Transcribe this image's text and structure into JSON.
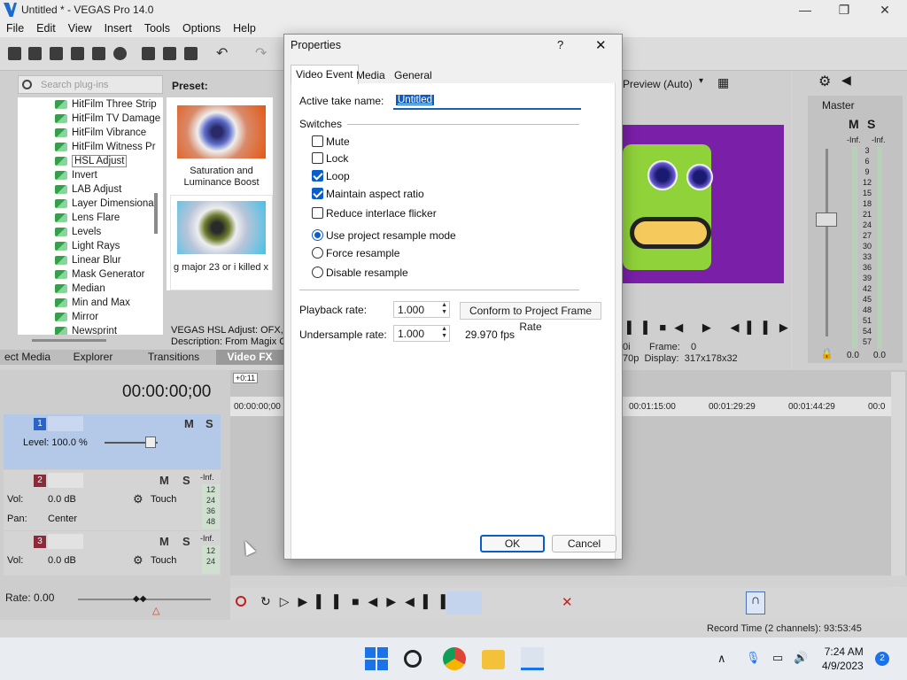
{
  "app": {
    "title": "Untitled * - VEGAS Pro 14.0",
    "menu": [
      "File",
      "Edit",
      "View",
      "Insert",
      "Tools",
      "Options",
      "Help"
    ]
  },
  "plugins": {
    "search_placeholder": "Search plug-ins",
    "preset_label": "Preset:",
    "items": [
      "HitFilm Three Strip",
      "HitFilm TV Damage",
      "HitFilm Vibrance",
      "HitFilm Witness Pr",
      "HSL Adjust",
      "Invert",
      "LAB Adjust",
      "Layer Dimensional",
      "Lens Flare",
      "Levels",
      "Light Rays",
      "Linear Blur",
      "Mask Generator",
      "Median",
      "Min and Max",
      "Mirror",
      "Newsprint"
    ],
    "selected_index": 4,
    "presets": [
      {
        "label": "Saturation and Luminance Boost"
      },
      {
        "label": "g major 23 or i killed x"
      }
    ],
    "description_line1": "VEGAS HSL Adjust: OFX, 32",
    "description_line2": "Description: From Magix Co",
    "tabs": [
      "ect Media",
      "Explorer",
      "Transitions",
      "Video FX"
    ]
  },
  "timeline": {
    "timecode": "00:00:00;00",
    "offset_badge": "+0:11",
    "ruler_marks": [
      "00:00:00;00",
      "00:01:15:00",
      "00:01:29:29",
      "00:01:44:29",
      "00:0"
    ],
    "rate": "Rate: 0.00",
    "tracks": [
      {
        "num": "1",
        "level_label": "Level: 100.0 %"
      },
      {
        "num": "2",
        "vol_label": "Vol:",
        "vol_value": "0.0 dB",
        "pan_label": "Pan:",
        "pan_value": "Center",
        "touch": "Touch"
      },
      {
        "num": "3",
        "vol_label": "Vol:",
        "vol_value": "0.0 dB",
        "touch": "Touch"
      }
    ],
    "meter_values": [
      "-Inf.",
      "12",
      "24",
      "36",
      "48"
    ]
  },
  "preview": {
    "mode": "Preview (Auto)",
    "frame_label": "Frame:",
    "frame_value": "0",
    "display_label": "Display:",
    "display_value": "317x178x32",
    "res_fragment1": "0i",
    "res_fragment2": "70p"
  },
  "master": {
    "label": "Master",
    "inf_left": "-Inf.",
    "inf_right": "-Inf.",
    "scale": [
      "3",
      "6",
      "9",
      "12",
      "15",
      "18",
      "21",
      "24",
      "27",
      "30",
      "33",
      "36",
      "39",
      "42",
      "45",
      "48",
      "51",
      "54",
      "57"
    ],
    "value_left": "0.0",
    "value_right": "0.0"
  },
  "status": {
    "record_time": "Record Time (2 channels): 93:53:45"
  },
  "taskbar": {
    "time": "7:24 AM",
    "date": "4/9/2023",
    "badge": "2"
  },
  "dialog": {
    "title": "Properties",
    "help": "?",
    "close": "✕",
    "tabs": [
      "Video Event",
      "Media",
      "General"
    ],
    "take_name_label": "Active take name:",
    "take_name_value": "Untitled",
    "switches_label": "Switches",
    "checkboxes": [
      {
        "label": "Mute",
        "checked": false
      },
      {
        "label": "Lock",
        "checked": false
      },
      {
        "label": "Loop",
        "checked": true
      },
      {
        "label": "Maintain aspect ratio",
        "checked": true
      },
      {
        "label": "Reduce interlace flicker",
        "checked": false
      }
    ],
    "radios": [
      {
        "label": "Use project resample mode",
        "selected": true
      },
      {
        "label": "Force resample",
        "selected": false
      },
      {
        "label": "Disable resample",
        "selected": false
      }
    ],
    "playback_rate_label": "Playback rate:",
    "playback_rate_value": "1.000",
    "conform_button": "Conform to Project Frame Rate",
    "undersample_label": "Undersample rate:",
    "undersample_value": "1.000",
    "fps": "29.970 fps",
    "ok": "OK",
    "cancel": "Cancel"
  }
}
